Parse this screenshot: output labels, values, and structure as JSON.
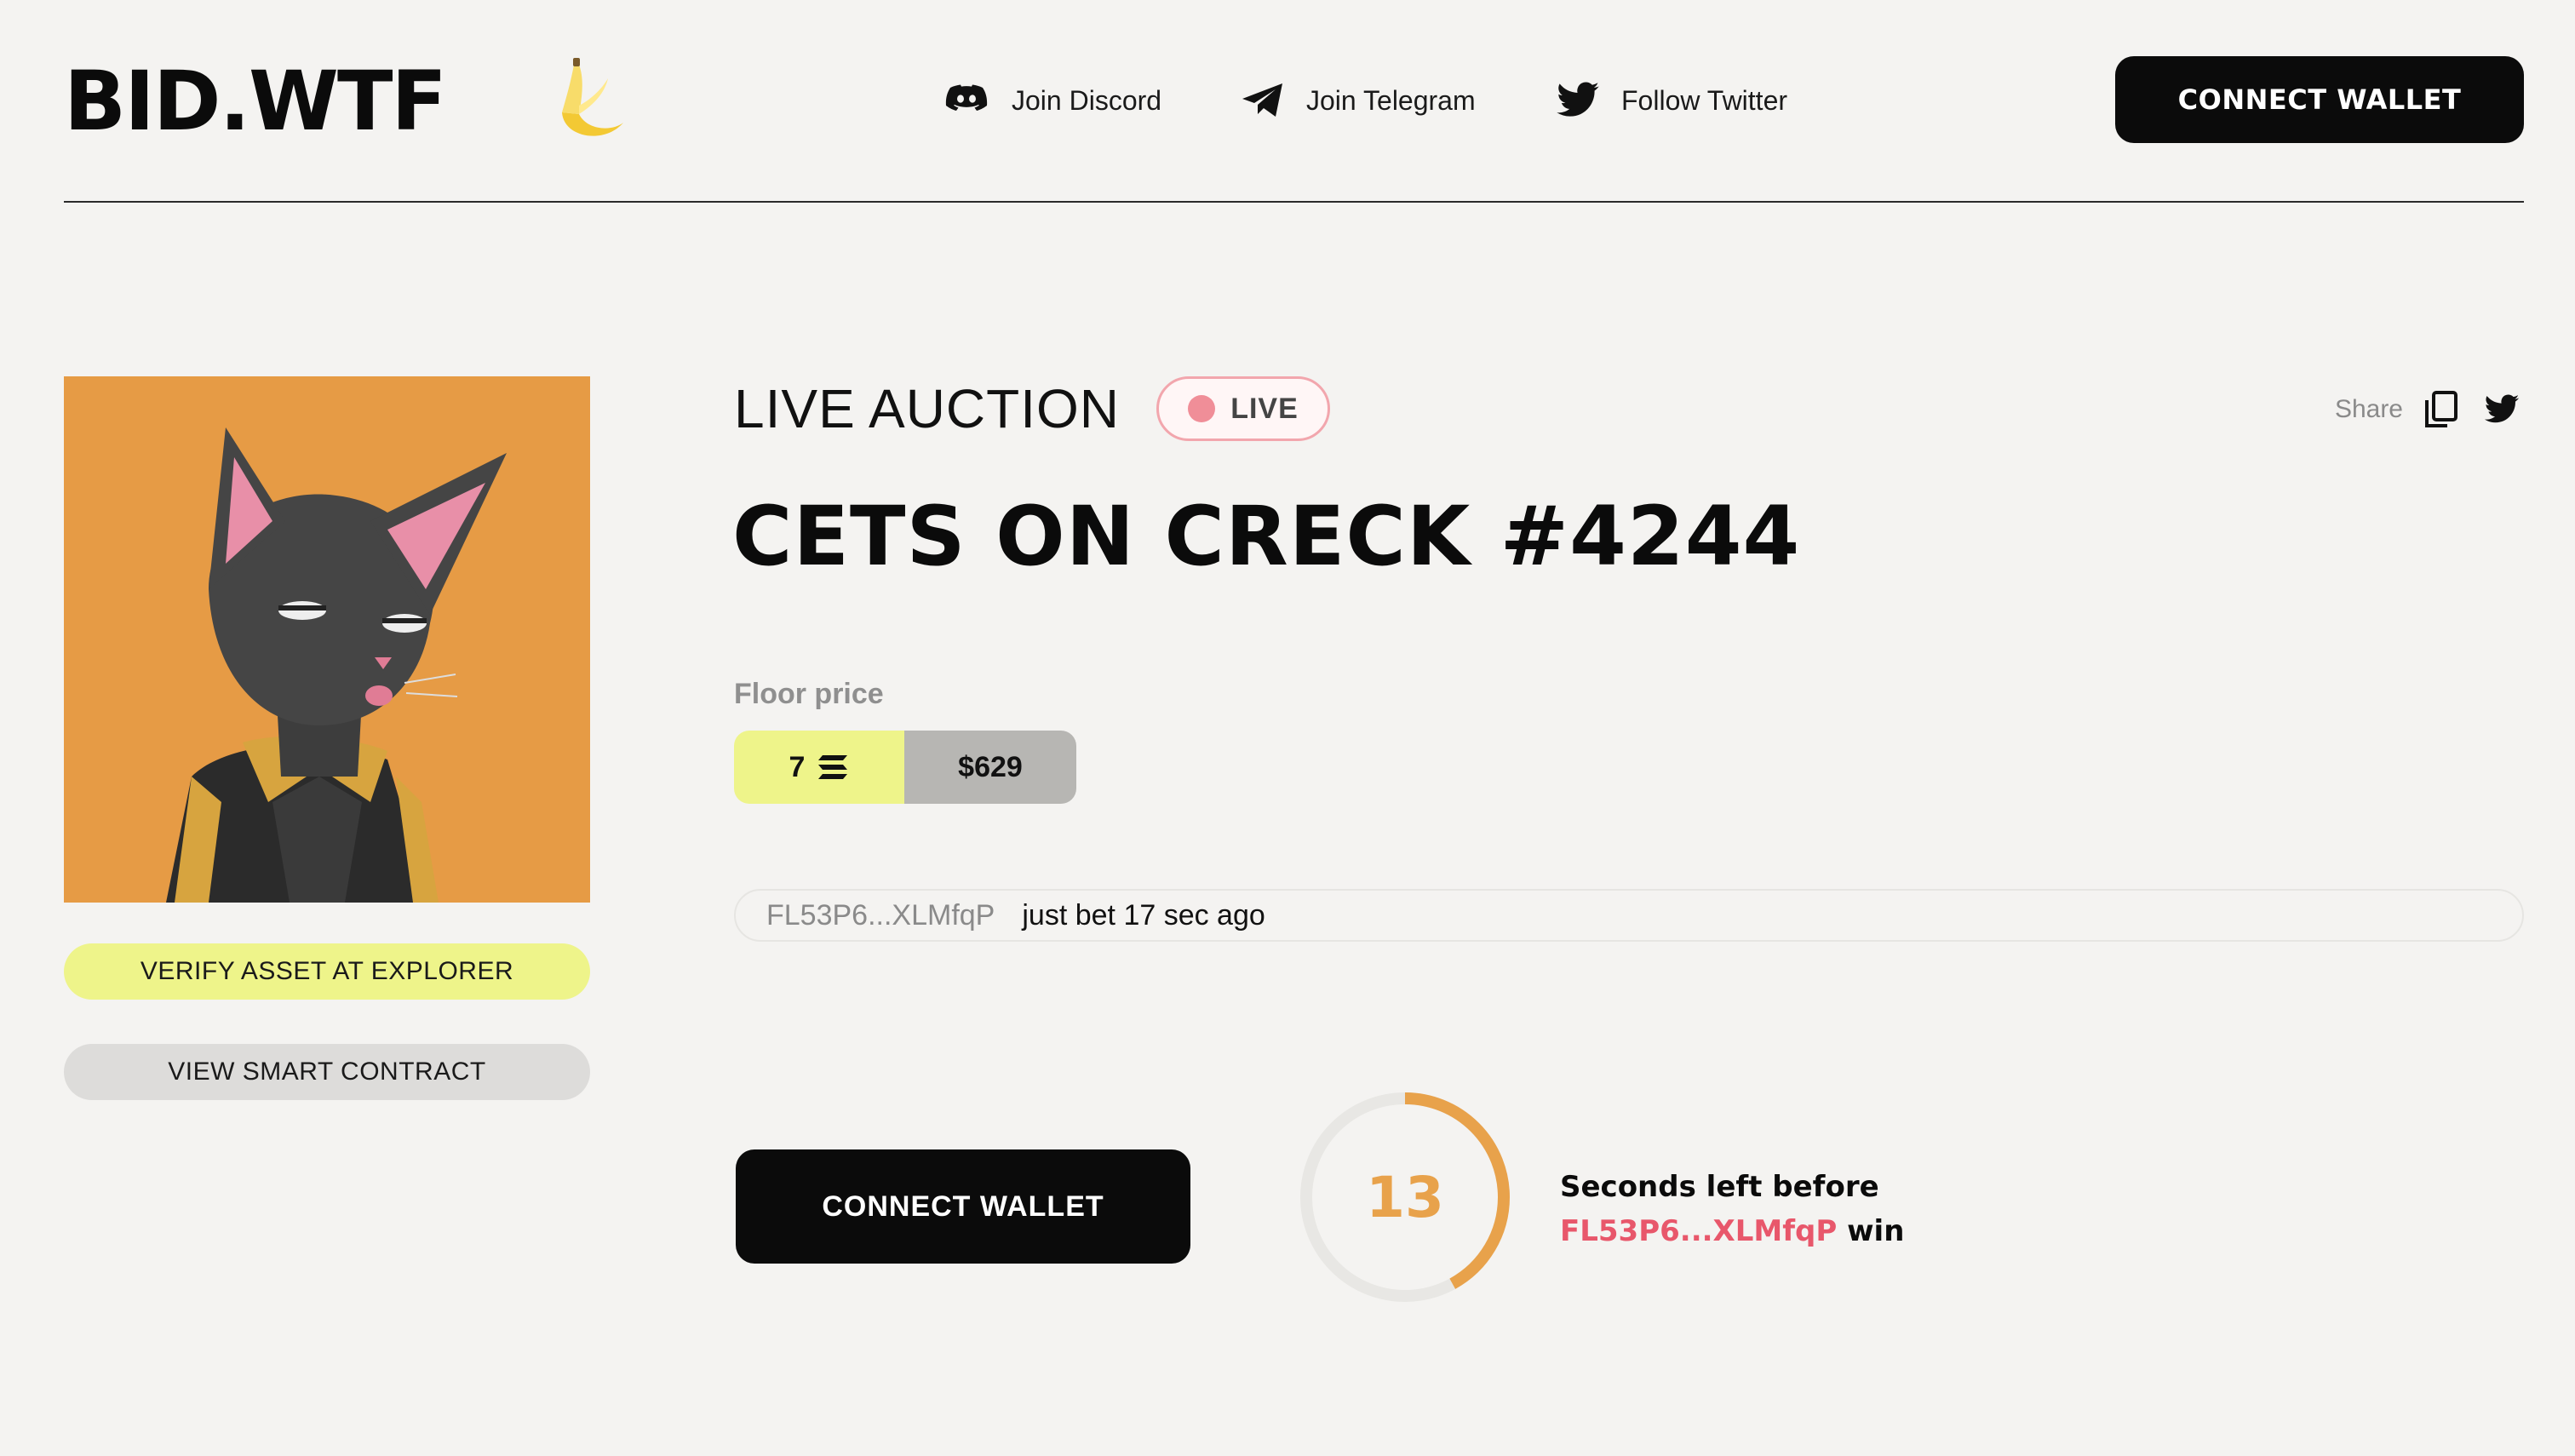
{
  "header": {
    "logo": "BID.WTF",
    "logo_icon": "banana-icon",
    "nav": [
      {
        "label": "Join Discord",
        "icon": "discord-icon"
      },
      {
        "label": "Join Telegram",
        "icon": "telegram-icon"
      },
      {
        "label": "Follow Twitter",
        "icon": "twitter-icon"
      }
    ],
    "connect_label": "CONNECT WALLET"
  },
  "asset": {
    "image": "cat-nft-image",
    "verify_label": "VERIFY ASSET AT EXPLORER",
    "contract_label": "VIEW SMART CONTRACT"
  },
  "auction": {
    "section_label": "LIVE AUCTION",
    "live_badge": "LIVE",
    "share_label": "Share",
    "title": "CETS ON CRECK #4244",
    "floor_label": "Floor price",
    "floor_sol": "7",
    "floor_usd": "$629",
    "activity": {
      "address": "FL53P6...XLMfqP",
      "text": "just bet 17 sec ago"
    },
    "connect_label": "CONNECT WALLET",
    "timer": {
      "value": "13",
      "progress": 0.42,
      "caption_line1": "Seconds left before",
      "caption_address": "FL53P6...XLMfqP",
      "caption_suffix": "win"
    }
  },
  "colors": {
    "background": "#f4f3f1",
    "accent_yellow": "#eef48a",
    "timer_orange": "#e8a24b",
    "live_pink": "#f08e98",
    "address_red": "#e8576b",
    "nft_background": "#e69b45"
  }
}
